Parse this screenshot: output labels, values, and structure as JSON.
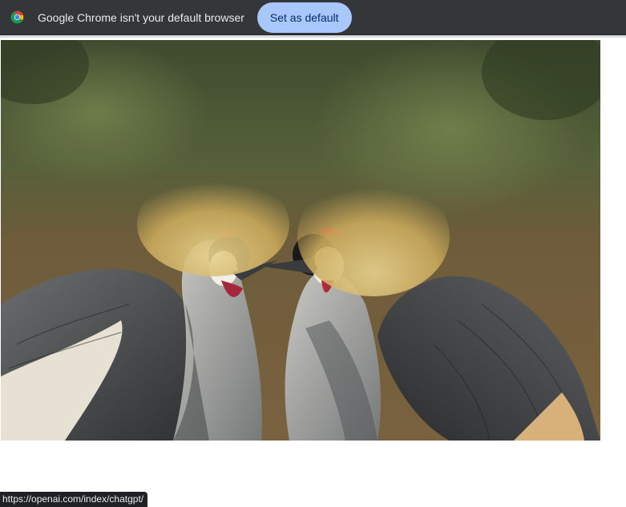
{
  "infobar": {
    "icon": "chrome-logo-icon",
    "message": "Google Chrome isn't your default browser",
    "button_label": "Set as default",
    "colors": {
      "bar_bg": "#35363a",
      "button_bg": "#a8c7fa",
      "button_text": "#062e6f"
    }
  },
  "content": {
    "image_subject": "two-grey-crowned-cranes-photo"
  },
  "status_bar": {
    "url": "https://openai.com/index/chatgpt/"
  }
}
